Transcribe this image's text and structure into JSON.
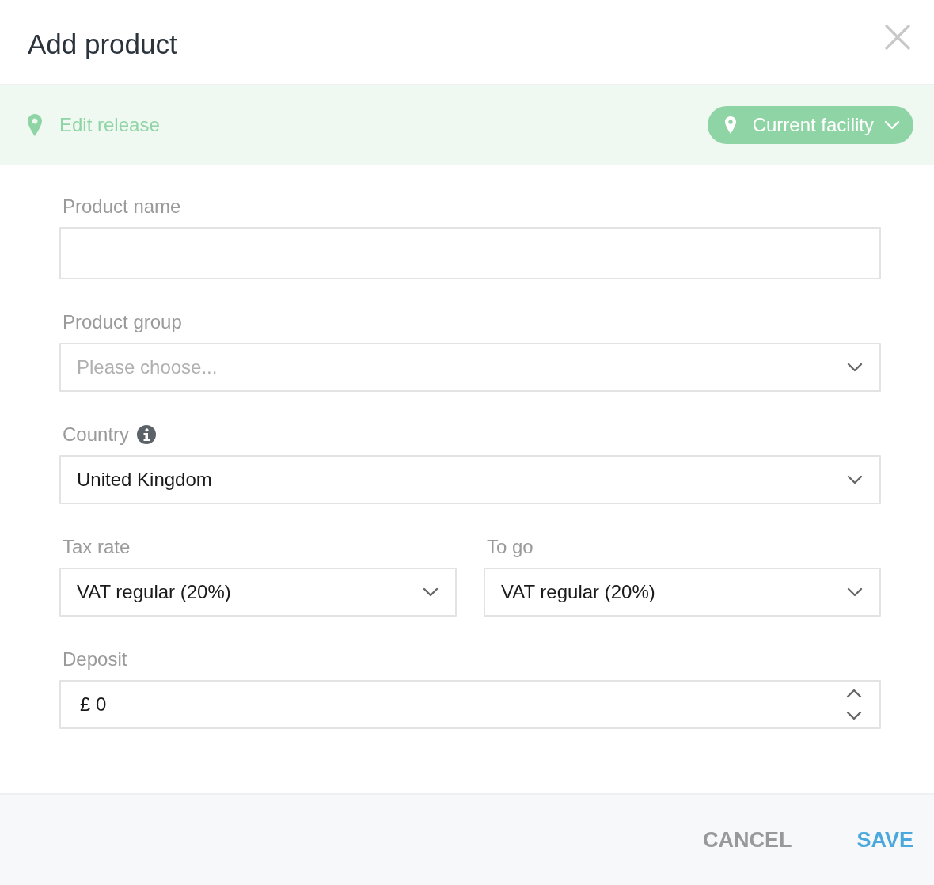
{
  "dialog": {
    "title": "Add product"
  },
  "release_bar": {
    "label": "Edit release",
    "facility_button": {
      "label": "Current facility"
    }
  },
  "form": {
    "rows": [
      {
        "fields": [
          {
            "kind": "text",
            "label": "Product name"
          }
        ]
      },
      {
        "fields": [
          {
            "kind": "select",
            "label": "Product group",
            "placeholder": "Please choose..."
          }
        ]
      },
      {
        "fields": [
          {
            "kind": "select",
            "label": "Country",
            "info": true,
            "value": "United Kingdom"
          }
        ]
      },
      {
        "fields": [
          {
            "kind": "select",
            "label": "Tax rate",
            "value": "VAT regular (20%)"
          },
          {
            "kind": "select",
            "label": "To go",
            "value": "VAT regular (20%)"
          }
        ]
      },
      {
        "fields": [
          {
            "kind": "number",
            "label": "Deposit",
            "value": "£ 0"
          }
        ]
      }
    ]
  },
  "footer": {
    "buttons": [
      {
        "kind": "secondary",
        "label": "CANCEL"
      },
      {
        "kind": "primary",
        "label": "SAVE"
      }
    ]
  }
}
